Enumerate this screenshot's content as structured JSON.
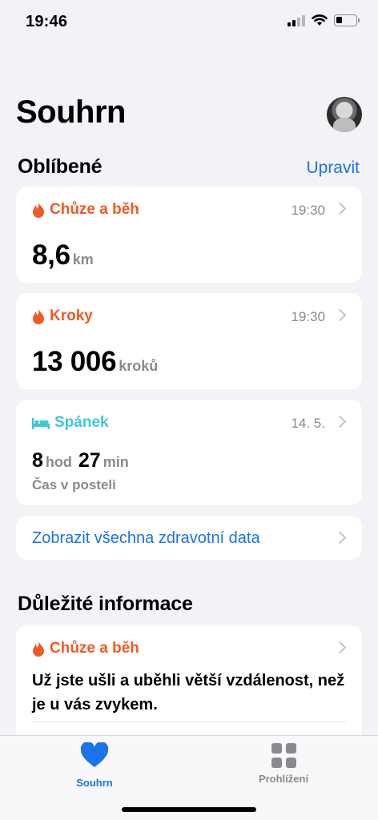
{
  "status": {
    "time": "19:46"
  },
  "header": {
    "title": "Souhrn"
  },
  "favorites": {
    "title": "Oblíbené",
    "edit_label": "Upravit",
    "walking": {
      "label": "Chůze a běh",
      "time": "19:30",
      "value": "8,6",
      "unit": "km"
    },
    "steps": {
      "label": "Kroky",
      "time": "19:30",
      "value": "13 006",
      "unit": "kroků"
    },
    "sleep": {
      "label": "Spánek",
      "date": "14. 5.",
      "hours": "8",
      "hours_unit": "hod",
      "minutes": "27",
      "minutes_unit": "min",
      "caption": "Čas v posteli"
    },
    "show_all_label": "Zobrazit všechna zdravotní data"
  },
  "highlights": {
    "title": "Důležité informace",
    "card": {
      "label": "Chůze a běh",
      "text": "Už jste ušli a uběhli větší vzdálenost, než je u vás zvykem."
    }
  },
  "tabs": [
    {
      "label": "Souhrn",
      "icon": "heart-icon",
      "active": true
    },
    {
      "label": "Prohlížení",
      "icon": "grid-icon",
      "active": false
    }
  ],
  "colors": {
    "accent": "#1a73e8",
    "activity": "#f15a24",
    "sleep": "#40c8d3",
    "background": "#f2f2f7"
  }
}
